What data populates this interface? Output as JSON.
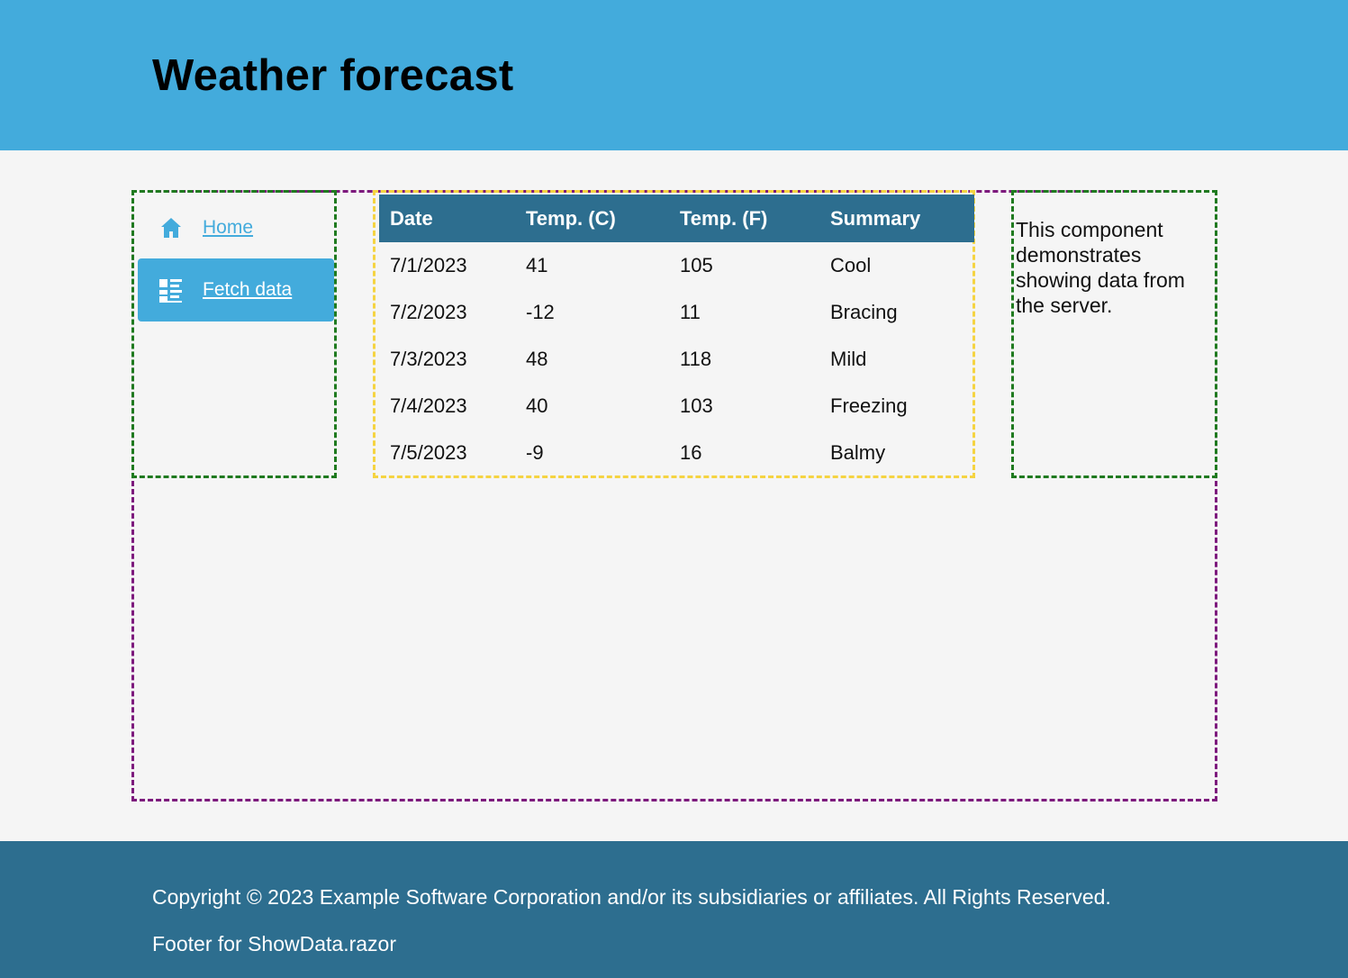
{
  "header": {
    "title": "Weather forecast"
  },
  "nav": {
    "items": [
      {
        "label": "Home",
        "icon": "home-icon",
        "active": false
      },
      {
        "label": "Fetch data",
        "icon": "list-icon",
        "active": true
      }
    ]
  },
  "table": {
    "columns": [
      "Date",
      "Temp. (C)",
      "Temp. (F)",
      "Summary"
    ],
    "rows": [
      [
        "7/1/2023",
        "41",
        "105",
        "Cool"
      ],
      [
        "7/2/2023",
        "-12",
        "11",
        "Bracing"
      ],
      [
        "7/3/2023",
        "48",
        "118",
        "Mild"
      ],
      [
        "7/4/2023",
        "40",
        "103",
        "Freezing"
      ],
      [
        "7/5/2023",
        "-9",
        "16",
        "Balmy"
      ]
    ]
  },
  "aside": {
    "text": "This component demonstrates showing data from the server."
  },
  "footer": {
    "copyright": "Copyright © 2023 Example Software Corporation and/or its subsidiaries or affiliates. All Rights Reserved.",
    "note": "Footer for ShowData.razor"
  },
  "colors": {
    "header_bg": "#43abdc",
    "table_header_bg": "#2d6e8f",
    "footer_bg": "#2d6e8f",
    "outer_border": "#7d1a7d",
    "panel_border": "#1f7a1f",
    "table_border": "#f5d442"
  }
}
